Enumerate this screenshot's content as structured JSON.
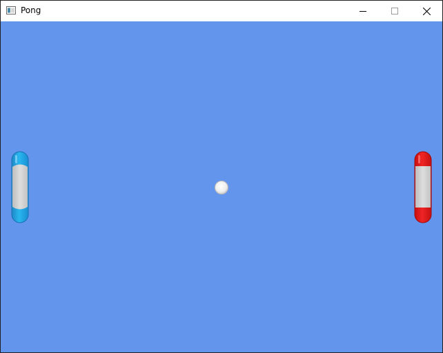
{
  "window": {
    "title": "Pong",
    "controls": [
      "minimize",
      "maximize",
      "close"
    ]
  },
  "game": {
    "background_color": "#6495ED",
    "left_paddle": {
      "color": "blue"
    },
    "right_paddle": {
      "color": "red"
    },
    "ball": {
      "color": "white"
    }
  }
}
